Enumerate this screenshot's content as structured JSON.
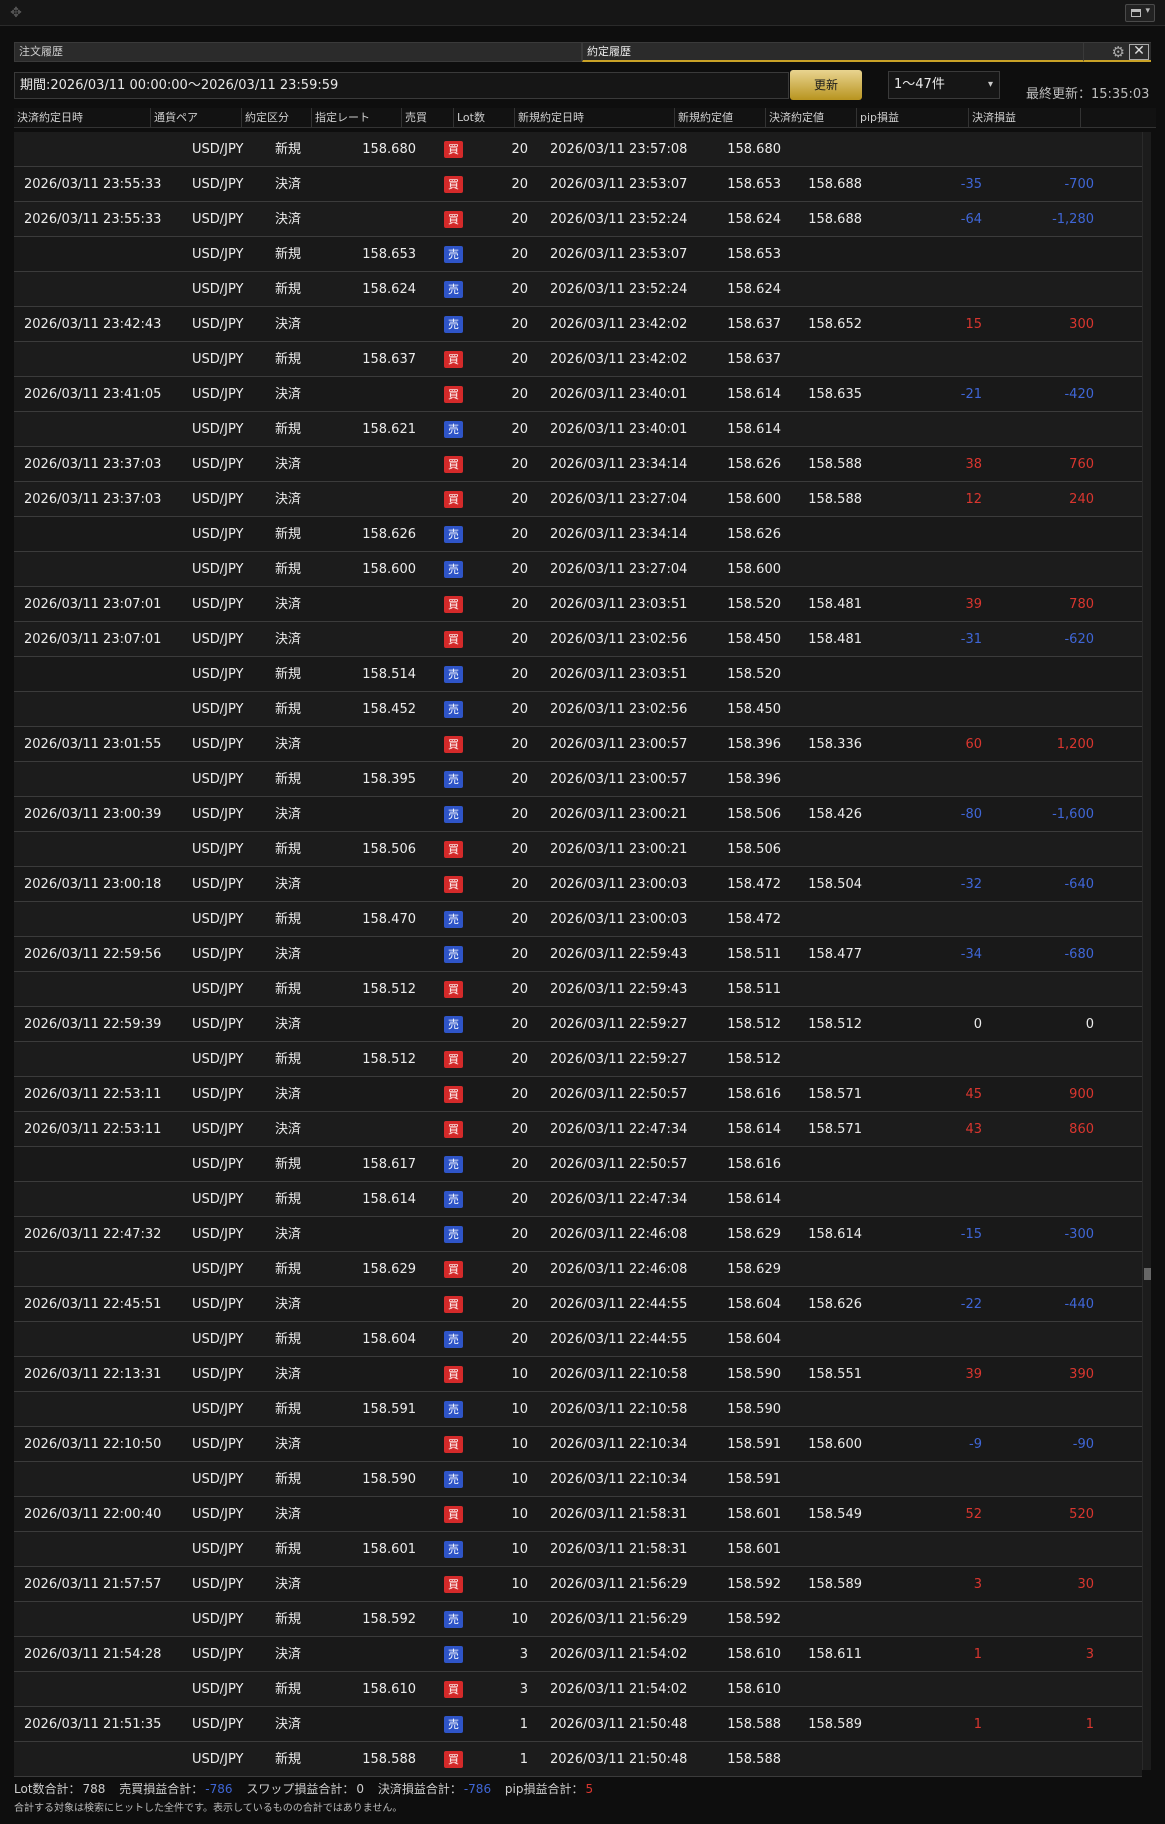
{
  "window": {
    "move_icon": "✥"
  },
  "tabs": [
    {
      "label": "注文履歴"
    },
    {
      "label": "約定履歴"
    }
  ],
  "toolbar": {
    "period": "期間:2026/03/11 00:00:00～2026/03/11 23:59:59",
    "refresh_label": "更新",
    "range_value": "1～47件",
    "last_update": "最終更新：15:35:03"
  },
  "columns": [
    "決済約定日時",
    "通貨ペア",
    "約定区分",
    "指定レート",
    "売買",
    "Lot数",
    "新規約定日時",
    "新規約定値",
    "決済約定値",
    "pip損益",
    "決済損益"
  ],
  "rows": [
    {
      "date": "",
      "pair": "USD/JPY",
      "type": "新規",
      "rate": "158.680",
      "side": "買",
      "lot": "20",
      "odate": "2026/03/11 23:57:08",
      "orate": "158.680",
      "crate": "",
      "pip": "",
      "pl": "",
      "sign": ""
    },
    {
      "date": "2026/03/11 23:55:33",
      "pair": "USD/JPY",
      "type": "決済",
      "rate": "",
      "side": "買",
      "lot": "20",
      "odate": "2026/03/11 23:53:07",
      "orate": "158.653",
      "crate": "158.688",
      "pip": "-35",
      "pl": "-700",
      "sign": "neg"
    },
    {
      "date": "2026/03/11 23:55:33",
      "pair": "USD/JPY",
      "type": "決済",
      "rate": "",
      "side": "買",
      "lot": "20",
      "odate": "2026/03/11 23:52:24",
      "orate": "158.624",
      "crate": "158.688",
      "pip": "-64",
      "pl": "-1,280",
      "sign": "neg"
    },
    {
      "date": "",
      "pair": "USD/JPY",
      "type": "新規",
      "rate": "158.653",
      "side": "売",
      "lot": "20",
      "odate": "2026/03/11 23:53:07",
      "orate": "158.653",
      "crate": "",
      "pip": "",
      "pl": "",
      "sign": ""
    },
    {
      "date": "",
      "pair": "USD/JPY",
      "type": "新規",
      "rate": "158.624",
      "side": "売",
      "lot": "20",
      "odate": "2026/03/11 23:52:24",
      "orate": "158.624",
      "crate": "",
      "pip": "",
      "pl": "",
      "sign": ""
    },
    {
      "date": "2026/03/11 23:42:43",
      "pair": "USD/JPY",
      "type": "決済",
      "rate": "",
      "side": "売",
      "lot": "20",
      "odate": "2026/03/11 23:42:02",
      "orate": "158.637",
      "crate": "158.652",
      "pip": "15",
      "pl": "300",
      "sign": "pos"
    },
    {
      "date": "",
      "pair": "USD/JPY",
      "type": "新規",
      "rate": "158.637",
      "side": "買",
      "lot": "20",
      "odate": "2026/03/11 23:42:02",
      "orate": "158.637",
      "crate": "",
      "pip": "",
      "pl": "",
      "sign": ""
    },
    {
      "date": "2026/03/11 23:41:05",
      "pair": "USD/JPY",
      "type": "決済",
      "rate": "",
      "side": "買",
      "lot": "20",
      "odate": "2026/03/11 23:40:01",
      "orate": "158.614",
      "crate": "158.635",
      "pip": "-21",
      "pl": "-420",
      "sign": "neg"
    },
    {
      "date": "",
      "pair": "USD/JPY",
      "type": "新規",
      "rate": "158.621",
      "side": "売",
      "lot": "20",
      "odate": "2026/03/11 23:40:01",
      "orate": "158.614",
      "crate": "",
      "pip": "",
      "pl": "",
      "sign": ""
    },
    {
      "date": "2026/03/11 23:37:03",
      "pair": "USD/JPY",
      "type": "決済",
      "rate": "",
      "side": "買",
      "lot": "20",
      "odate": "2026/03/11 23:34:14",
      "orate": "158.626",
      "crate": "158.588",
      "pip": "38",
      "pl": "760",
      "sign": "pos"
    },
    {
      "date": "2026/03/11 23:37:03",
      "pair": "USD/JPY",
      "type": "決済",
      "rate": "",
      "side": "買",
      "lot": "20",
      "odate": "2026/03/11 23:27:04",
      "orate": "158.600",
      "crate": "158.588",
      "pip": "12",
      "pl": "240",
      "sign": "pos"
    },
    {
      "date": "",
      "pair": "USD/JPY",
      "type": "新規",
      "rate": "158.626",
      "side": "売",
      "lot": "20",
      "odate": "2026/03/11 23:34:14",
      "orate": "158.626",
      "crate": "",
      "pip": "",
      "pl": "",
      "sign": ""
    },
    {
      "date": "",
      "pair": "USD/JPY",
      "type": "新規",
      "rate": "158.600",
      "side": "売",
      "lot": "20",
      "odate": "2026/03/11 23:27:04",
      "orate": "158.600",
      "crate": "",
      "pip": "",
      "pl": "",
      "sign": ""
    },
    {
      "date": "2026/03/11 23:07:01",
      "pair": "USD/JPY",
      "type": "決済",
      "rate": "",
      "side": "買",
      "lot": "20",
      "odate": "2026/03/11 23:03:51",
      "orate": "158.520",
      "crate": "158.481",
      "pip": "39",
      "pl": "780",
      "sign": "pos"
    },
    {
      "date": "2026/03/11 23:07:01",
      "pair": "USD/JPY",
      "type": "決済",
      "rate": "",
      "side": "買",
      "lot": "20",
      "odate": "2026/03/11 23:02:56",
      "orate": "158.450",
      "crate": "158.481",
      "pip": "-31",
      "pl": "-620",
      "sign": "neg"
    },
    {
      "date": "",
      "pair": "USD/JPY",
      "type": "新規",
      "rate": "158.514",
      "side": "売",
      "lot": "20",
      "odate": "2026/03/11 23:03:51",
      "orate": "158.520",
      "crate": "",
      "pip": "",
      "pl": "",
      "sign": ""
    },
    {
      "date": "",
      "pair": "USD/JPY",
      "type": "新規",
      "rate": "158.452",
      "side": "売",
      "lot": "20",
      "odate": "2026/03/11 23:02:56",
      "orate": "158.450",
      "crate": "",
      "pip": "",
      "pl": "",
      "sign": ""
    },
    {
      "date": "2026/03/11 23:01:55",
      "pair": "USD/JPY",
      "type": "決済",
      "rate": "",
      "side": "買",
      "lot": "20",
      "odate": "2026/03/11 23:00:57",
      "orate": "158.396",
      "crate": "158.336",
      "pip": "60",
      "pl": "1,200",
      "sign": "pos"
    },
    {
      "date": "",
      "pair": "USD/JPY",
      "type": "新規",
      "rate": "158.395",
      "side": "売",
      "lot": "20",
      "odate": "2026/03/11 23:00:57",
      "orate": "158.396",
      "crate": "",
      "pip": "",
      "pl": "",
      "sign": ""
    },
    {
      "date": "2026/03/11 23:00:39",
      "pair": "USD/JPY",
      "type": "決済",
      "rate": "",
      "side": "売",
      "lot": "20",
      "odate": "2026/03/11 23:00:21",
      "orate": "158.506",
      "crate": "158.426",
      "pip": "-80",
      "pl": "-1,600",
      "sign": "neg"
    },
    {
      "date": "",
      "pair": "USD/JPY",
      "type": "新規",
      "rate": "158.506",
      "side": "買",
      "lot": "20",
      "odate": "2026/03/11 23:00:21",
      "orate": "158.506",
      "crate": "",
      "pip": "",
      "pl": "",
      "sign": ""
    },
    {
      "date": "2026/03/11 23:00:18",
      "pair": "USD/JPY",
      "type": "決済",
      "rate": "",
      "side": "買",
      "lot": "20",
      "odate": "2026/03/11 23:00:03",
      "orate": "158.472",
      "crate": "158.504",
      "pip": "-32",
      "pl": "-640",
      "sign": "neg"
    },
    {
      "date": "",
      "pair": "USD/JPY",
      "type": "新規",
      "rate": "158.470",
      "side": "売",
      "lot": "20",
      "odate": "2026/03/11 23:00:03",
      "orate": "158.472",
      "crate": "",
      "pip": "",
      "pl": "",
      "sign": ""
    },
    {
      "date": "2026/03/11 22:59:56",
      "pair": "USD/JPY",
      "type": "決済",
      "rate": "",
      "side": "売",
      "lot": "20",
      "odate": "2026/03/11 22:59:43",
      "orate": "158.511",
      "crate": "158.477",
      "pip": "-34",
      "pl": "-680",
      "sign": "neg"
    },
    {
      "date": "",
      "pair": "USD/JPY",
      "type": "新規",
      "rate": "158.512",
      "side": "買",
      "lot": "20",
      "odate": "2026/03/11 22:59:43",
      "orate": "158.511",
      "crate": "",
      "pip": "",
      "pl": "",
      "sign": ""
    },
    {
      "date": "2026/03/11 22:59:39",
      "pair": "USD/JPY",
      "type": "決済",
      "rate": "",
      "side": "売",
      "lot": "20",
      "odate": "2026/03/11 22:59:27",
      "orate": "158.512",
      "crate": "158.512",
      "pip": "0",
      "pl": "0",
      "sign": "zero"
    },
    {
      "date": "",
      "pair": "USD/JPY",
      "type": "新規",
      "rate": "158.512",
      "side": "買",
      "lot": "20",
      "odate": "2026/03/11 22:59:27",
      "orate": "158.512",
      "crate": "",
      "pip": "",
      "pl": "",
      "sign": ""
    },
    {
      "date": "2026/03/11 22:53:11",
      "pair": "USD/JPY",
      "type": "決済",
      "rate": "",
      "side": "買",
      "lot": "20",
      "odate": "2026/03/11 22:50:57",
      "orate": "158.616",
      "crate": "158.571",
      "pip": "45",
      "pl": "900",
      "sign": "pos"
    },
    {
      "date": "2026/03/11 22:53:11",
      "pair": "USD/JPY",
      "type": "決済",
      "rate": "",
      "side": "買",
      "lot": "20",
      "odate": "2026/03/11 22:47:34",
      "orate": "158.614",
      "crate": "158.571",
      "pip": "43",
      "pl": "860",
      "sign": "pos"
    },
    {
      "date": "",
      "pair": "USD/JPY",
      "type": "新規",
      "rate": "158.617",
      "side": "売",
      "lot": "20",
      "odate": "2026/03/11 22:50:57",
      "orate": "158.616",
      "crate": "",
      "pip": "",
      "pl": "",
      "sign": ""
    },
    {
      "date": "",
      "pair": "USD/JPY",
      "type": "新規",
      "rate": "158.614",
      "side": "売",
      "lot": "20",
      "odate": "2026/03/11 22:47:34",
      "orate": "158.614",
      "crate": "",
      "pip": "",
      "pl": "",
      "sign": ""
    },
    {
      "date": "2026/03/11 22:47:32",
      "pair": "USD/JPY",
      "type": "決済",
      "rate": "",
      "side": "売",
      "lot": "20",
      "odate": "2026/03/11 22:46:08",
      "orate": "158.629",
      "crate": "158.614",
      "pip": "-15",
      "pl": "-300",
      "sign": "neg"
    },
    {
      "date": "",
      "pair": "USD/JPY",
      "type": "新規",
      "rate": "158.629",
      "side": "買",
      "lot": "20",
      "odate": "2026/03/11 22:46:08",
      "orate": "158.629",
      "crate": "",
      "pip": "",
      "pl": "",
      "sign": ""
    },
    {
      "date": "2026/03/11 22:45:51",
      "pair": "USD/JPY",
      "type": "決済",
      "rate": "",
      "side": "買",
      "lot": "20",
      "odate": "2026/03/11 22:44:55",
      "orate": "158.604",
      "crate": "158.626",
      "pip": "-22",
      "pl": "-440",
      "sign": "neg"
    },
    {
      "date": "",
      "pair": "USD/JPY",
      "type": "新規",
      "rate": "158.604",
      "side": "売",
      "lot": "20",
      "odate": "2026/03/11 22:44:55",
      "orate": "158.604",
      "crate": "",
      "pip": "",
      "pl": "",
      "sign": ""
    },
    {
      "date": "2026/03/11 22:13:31",
      "pair": "USD/JPY",
      "type": "決済",
      "rate": "",
      "side": "買",
      "lot": "10",
      "odate": "2026/03/11 22:10:58",
      "orate": "158.590",
      "crate": "158.551",
      "pip": "39",
      "pl": "390",
      "sign": "pos"
    },
    {
      "date": "",
      "pair": "USD/JPY",
      "type": "新規",
      "rate": "158.591",
      "side": "売",
      "lot": "10",
      "odate": "2026/03/11 22:10:58",
      "orate": "158.590",
      "crate": "",
      "pip": "",
      "pl": "",
      "sign": ""
    },
    {
      "date": "2026/03/11 22:10:50",
      "pair": "USD/JPY",
      "type": "決済",
      "rate": "",
      "side": "買",
      "lot": "10",
      "odate": "2026/03/11 22:10:34",
      "orate": "158.591",
      "crate": "158.600",
      "pip": "-9",
      "pl": "-90",
      "sign": "neg"
    },
    {
      "date": "",
      "pair": "USD/JPY",
      "type": "新規",
      "rate": "158.590",
      "side": "売",
      "lot": "10",
      "odate": "2026/03/11 22:10:34",
      "orate": "158.591",
      "crate": "",
      "pip": "",
      "pl": "",
      "sign": ""
    },
    {
      "date": "2026/03/11 22:00:40",
      "pair": "USD/JPY",
      "type": "決済",
      "rate": "",
      "side": "買",
      "lot": "10",
      "odate": "2026/03/11 21:58:31",
      "orate": "158.601",
      "crate": "158.549",
      "pip": "52",
      "pl": "520",
      "sign": "pos"
    },
    {
      "date": "",
      "pair": "USD/JPY",
      "type": "新規",
      "rate": "158.601",
      "side": "売",
      "lot": "10",
      "odate": "2026/03/11 21:58:31",
      "orate": "158.601",
      "crate": "",
      "pip": "",
      "pl": "",
      "sign": ""
    },
    {
      "date": "2026/03/11 21:57:57",
      "pair": "USD/JPY",
      "type": "決済",
      "rate": "",
      "side": "買",
      "lot": "10",
      "odate": "2026/03/11 21:56:29",
      "orate": "158.592",
      "crate": "158.589",
      "pip": "3",
      "pl": "30",
      "sign": "pos"
    },
    {
      "date": "",
      "pair": "USD/JPY",
      "type": "新規",
      "rate": "158.592",
      "side": "売",
      "lot": "10",
      "odate": "2026/03/11 21:56:29",
      "orate": "158.592",
      "crate": "",
      "pip": "",
      "pl": "",
      "sign": ""
    },
    {
      "date": "2026/03/11 21:54:28",
      "pair": "USD/JPY",
      "type": "決済",
      "rate": "",
      "side": "売",
      "lot": "3",
      "odate": "2026/03/11 21:54:02",
      "orate": "158.610",
      "crate": "158.611",
      "pip": "1",
      "pl": "3",
      "sign": "pos"
    },
    {
      "date": "",
      "pair": "USD/JPY",
      "type": "新規",
      "rate": "158.610",
      "side": "買",
      "lot": "3",
      "odate": "2026/03/11 21:54:02",
      "orate": "158.610",
      "crate": "",
      "pip": "",
      "pl": "",
      "sign": ""
    },
    {
      "date": "2026/03/11 21:51:35",
      "pair": "USD/JPY",
      "type": "決済",
      "rate": "",
      "side": "売",
      "lot": "1",
      "odate": "2026/03/11 21:50:48",
      "orate": "158.588",
      "crate": "158.589",
      "pip": "1",
      "pl": "1",
      "sign": "pos"
    },
    {
      "date": "",
      "pair": "USD/JPY",
      "type": "新規",
      "rate": "158.588",
      "side": "買",
      "lot": "1",
      "odate": "2026/03/11 21:50:48",
      "orate": "158.588",
      "crate": "",
      "pip": "",
      "pl": "",
      "sign": ""
    }
  ],
  "footer": {
    "lot_label": "Lot数合計：",
    "lot_value": "788",
    "trade_pl_label": "売買損益合計：",
    "trade_pl_value": "-786",
    "swap_label": "スワップ損益合計：",
    "swap_value": "0",
    "settle_label": "決済損益合計：",
    "settle_value": "-786",
    "pip_label": "pip損益合計：",
    "pip_value": "5",
    "note": "合計する対象は検索にヒットした全件です。表示しているものの合計ではありません。"
  },
  "colors": {
    "buy": "#d42a2a",
    "sell": "#2f55c8",
    "positive": "#d9362f",
    "negative": "#3f66d6",
    "accent": "#c9a227"
  }
}
